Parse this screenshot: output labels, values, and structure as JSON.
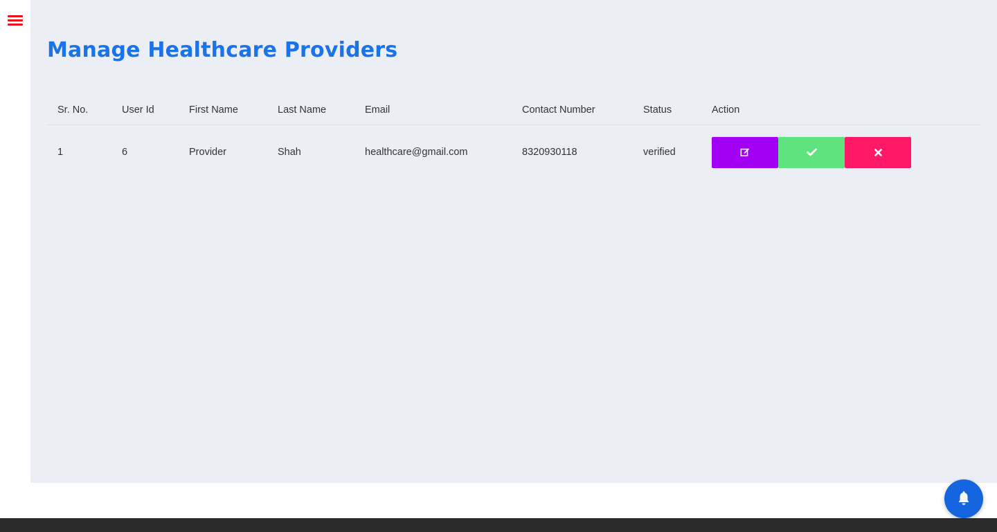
{
  "page": {
    "title": "Manage Healthcare Providers"
  },
  "menu": {
    "icon": "hamburger-menu-icon",
    "color": "#e8141c"
  },
  "table": {
    "headers": {
      "sr_no": "Sr. No.",
      "user_id": "User Id",
      "first_name": "First Name",
      "last_name": "Last Name",
      "email": "Email",
      "contact_number": "Contact Number",
      "status": "Status",
      "action": "Action"
    },
    "rows": [
      {
        "sr_no": "1",
        "user_id": "6",
        "first_name": "Provider",
        "last_name": "Shah",
        "email": "healthcare@gmail.com",
        "contact_number": "8320930118",
        "status": "verified",
        "actions": [
          {
            "icon": "edit-icon",
            "color": "#a100f2"
          },
          {
            "icon": "check-icon",
            "color": "#5fe37f"
          },
          {
            "icon": "close-icon",
            "color": "#ff1866"
          }
        ]
      }
    ]
  },
  "notification": {
    "icon": "bell-icon",
    "color": "#1565e0"
  },
  "colors": {
    "title": "#1a73e8",
    "main_background": "#ebeef4",
    "footer": "#2b2b2b"
  }
}
